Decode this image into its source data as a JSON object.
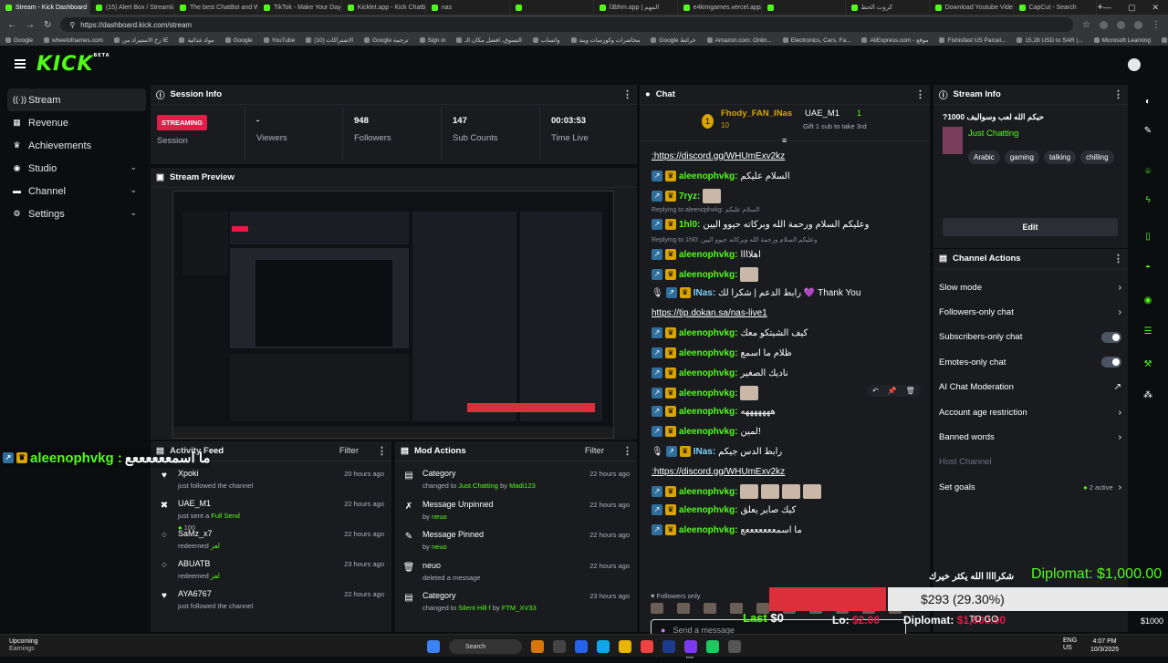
{
  "browser": {
    "tabs": [
      "Stream - Kick Dashboard",
      "(15) Alert Box / Streamlabs",
      "The best ChatBot and Widg...",
      "TikTok - Make Your Day",
      "Kicklet.app - Kick Chatbot a...",
      "nas",
      "",
      "l3bhm.app | المهم",
      "e4kimgames.vercel.app/gam",
      "",
      "كروت الحظ",
      "Download Youtube Videos",
      "CapCut - Search"
    ],
    "url": "https://dashboard.kick.com/stream",
    "bookmarks": [
      "Google",
      "wheelofnames.com",
      "زخ الاستيراد من IE",
      "مواد غذائية",
      "Google",
      "YouTube",
      "(10) الاشتراكات",
      "Google ترجمة",
      "Sign in",
      "التسوق، افضل مكان الـ",
      "واتساب",
      "محاضرات وكورسات ويند",
      "Google خرائط",
      "Amazon.com: Onlin...",
      "Electronics, Cars, Fa...",
      "AliExpress.com - موقع",
      "Fishisfast US Parcel...",
      "15.28 USD to SAR |...",
      "Microsoft Learning",
      "الكتب"
    ]
  },
  "app": {
    "logo": "KICK",
    "logo_sup": "BETA"
  },
  "sidebar": {
    "items": [
      {
        "label": "Stream",
        "icon": "broadcast-icon",
        "glyph": "((·))",
        "active": true
      },
      {
        "label": "Revenue",
        "icon": "revenue-icon",
        "glyph": "▦"
      },
      {
        "label": "Achievements",
        "icon": "trophy-icon",
        "glyph": "♛"
      },
      {
        "label": "Studio",
        "icon": "studio-icon",
        "glyph": "◉",
        "expandable": true
      },
      {
        "label": "Channel",
        "icon": "channel-icon",
        "glyph": "▬",
        "expandable": true
      },
      {
        "label": "Settings",
        "icon": "gear-icon",
        "glyph": "⚙",
        "expandable": true
      }
    ]
  },
  "session": {
    "title": "Session Info",
    "status": "STREAMING",
    "status_label": "Session",
    "viewers_value": "-",
    "viewers_label": "Viewers",
    "followers_value": "948",
    "followers_label": "Followers",
    "subs_value": "147",
    "subs_label": "Sub Counts",
    "time_value": "00:03:53",
    "time_label": "Time Live"
  },
  "preview": {
    "title": "Stream Preview"
  },
  "activity": {
    "title": "Activity Feed",
    "filter": "Filter",
    "items": [
      {
        "icon": "heart-icon",
        "glyph": "♥",
        "user": "Xpoki",
        "text": "just followed the channel",
        "extra": "",
        "ago": "20 hours ago"
      },
      {
        "icon": "gift-icon",
        "glyph": "✖",
        "user": "UAE_M1",
        "text": "just sent a ",
        "extra": "Full Send",
        "amount": "100",
        "ago": "22 hours ago"
      },
      {
        "icon": "redeem-icon",
        "glyph": "⁘",
        "user": "SaMz_x7",
        "text": "redeemed ",
        "extra": "لعز",
        "ago": "22 hours ago"
      },
      {
        "icon": "redeem-icon",
        "glyph": "⁘",
        "user": "ABUATB",
        "text": "redeemed ",
        "extra": "لعز",
        "ago": "23 hours ago"
      },
      {
        "icon": "heart-icon",
        "glyph": "♥",
        "user": "AYA6767",
        "text": "just followed the channel",
        "extra": "",
        "ago": "22 hours ago"
      }
    ]
  },
  "modactions": {
    "title": "Mod Actions",
    "filter": "Filter",
    "items": [
      {
        "icon": "category-icon",
        "glyph": "▤",
        "title": "Category",
        "pre": "changed to ",
        "hl1": "Just Chatting",
        "mid": " by ",
        "hl2": "Madi123",
        "ago": "22 hours ago"
      },
      {
        "icon": "unpin-icon",
        "glyph": "✗",
        "title": "Message Unpinned",
        "pre": "by ",
        "hl1": "neuo",
        "mid": "",
        "hl2": "",
        "ago": "22 hours ago"
      },
      {
        "icon": "pin-icon",
        "glyph": "✎",
        "title": "Message Pinned",
        "pre": "by ",
        "hl1": "neuo",
        "mid": "",
        "hl2": "",
        "ago": "22 hours ago"
      },
      {
        "icon": "trash-icon",
        "glyph": "🗑",
        "title": "neuo",
        "pre": "deleted a message",
        "hl1": "",
        "mid": "",
        "hl2": "",
        "ago": "22 hours ago"
      },
      {
        "icon": "category-icon",
        "glyph": "▤",
        "title": "Category",
        "pre": "changed to ",
        "hl1": "Silent Hill f",
        "mid": " by ",
        "hl2": "FTM_XV33",
        "ago": "23 hours ago"
      }
    ]
  },
  "chat": {
    "title": "Chat",
    "pinned_user1": "Fhody_FAN_INas",
    "pinned_count1": "10",
    "pinned_user2": "UAE_M1",
    "pinned_count2": "1",
    "pinned_sub": "Gift 1 sub to take 3rd",
    "messages": [
      {
        "user": "",
        "text": ":https://discord.gg/WHUmExv2kz",
        "link": true
      },
      {
        "user": "aleenophvkg:",
        "text": "السلام عليكم"
      },
      {
        "user": "7ryz:",
        "text": "",
        "emote": true
      },
      {
        "user": "1hl0:",
        "text": "وعليكم السلام ورحمة الله وبركاته حيوو اليين",
        "reply": "Replying to aleenophvkg: السلام عليكم"
      },
      {
        "user": "aleenophvkg:",
        "text": "اهلاااا",
        "reply": "Replying to 1hl0: وعليكم السلام ورحمة الله وبركاته حيوو اليين"
      },
      {
        "user": "aleenophvkg:",
        "text": "",
        "emote": true
      },
      {
        "user": "INas:",
        "text": "رابط الدعم | شكرا لك 💜 Thank You"
      },
      {
        "user": "",
        "text": "https://tip.dokan.sa/nas-live1",
        "link": true
      },
      {
        "user": "aleenophvkg:",
        "text": "كيف الشيتكو معك"
      },
      {
        "user": "aleenophvkg:",
        "text": "ظلام ما اسمع"
      },
      {
        "user": "aleenophvkg:",
        "text": "ناديك الصغير"
      },
      {
        "user": "aleenophvkg:",
        "text": "",
        "emote": true
      },
      {
        "user": "aleenophvkg:",
        "text": "هههههههه"
      },
      {
        "user": "aleenophvkg:",
        "text": "لمين!"
      },
      {
        "user": "INas:",
        "text": "رابط الدس جيكم"
      },
      {
        "user": "",
        "text": ":https://discord.gg/WHUmExv2kz",
        "link": true
      },
      {
        "user": "aleenophvkg:",
        "text": "",
        "emote": true
      },
      {
        "user": "aleenophvkg:",
        "text": "كيك صاير يعلق"
      },
      {
        "user": "aleenophvkg:",
        "text": "ما اسمعععععععع"
      }
    ],
    "followers_only": "Followers only",
    "input_placeholder": "Send a message"
  },
  "streaminfo": {
    "title": "Stream Info",
    "stream_title": "حيكم الله لعب وسواليف 1000?",
    "category": "Just Chatting",
    "tags": [
      "Arabic",
      "gaming",
      "talking",
      "chilling"
    ],
    "edit": "Edit"
  },
  "channelactions": {
    "title": "Channel Actions",
    "items": [
      {
        "label": "Slow mode",
        "type": "chevron"
      },
      {
        "label": "Followers-only chat",
        "type": "chevron"
      },
      {
        "label": "Subscribers-only chat",
        "type": "toggle"
      },
      {
        "label": "Emotes-only chat",
        "type": "toggle"
      },
      {
        "label": "AI Chat Moderation",
        "type": "external"
      },
      {
        "label": "Account age restriction",
        "type": "chevron"
      },
      {
        "label": "Banned words",
        "type": "chevron"
      },
      {
        "label": "Host Channel",
        "type": "disabled"
      },
      {
        "label": "Set goals",
        "type": "goals",
        "badge": "2 active"
      }
    ]
  },
  "overlay": {
    "left_user": "aleenophvkg :",
    "left_msg": "ما اسمععععععع",
    "diplomat": "Diplomat: $1,000.00",
    "goal_text": "$293 (29.30%)",
    "goal_progress": 0.293,
    "thanks": "شكراااا الله يكثر خيرك",
    "lo_label": "Lo:",
    "lo_val": "$2.00",
    "last_label": "Last",
    "last_val": "$0",
    "dip_label": "Diplomat:",
    "dip_val": "$1,000.00",
    "to_go": "TO GO",
    "thousand": "$1000"
  },
  "taskbar": {
    "weather_title": "Upcoming",
    "weather_sub": "Earnings",
    "search": "Search",
    "lang1": "ENG",
    "lang2": "US",
    "time": "4:07 PM",
    "date": "10/3/2025"
  }
}
